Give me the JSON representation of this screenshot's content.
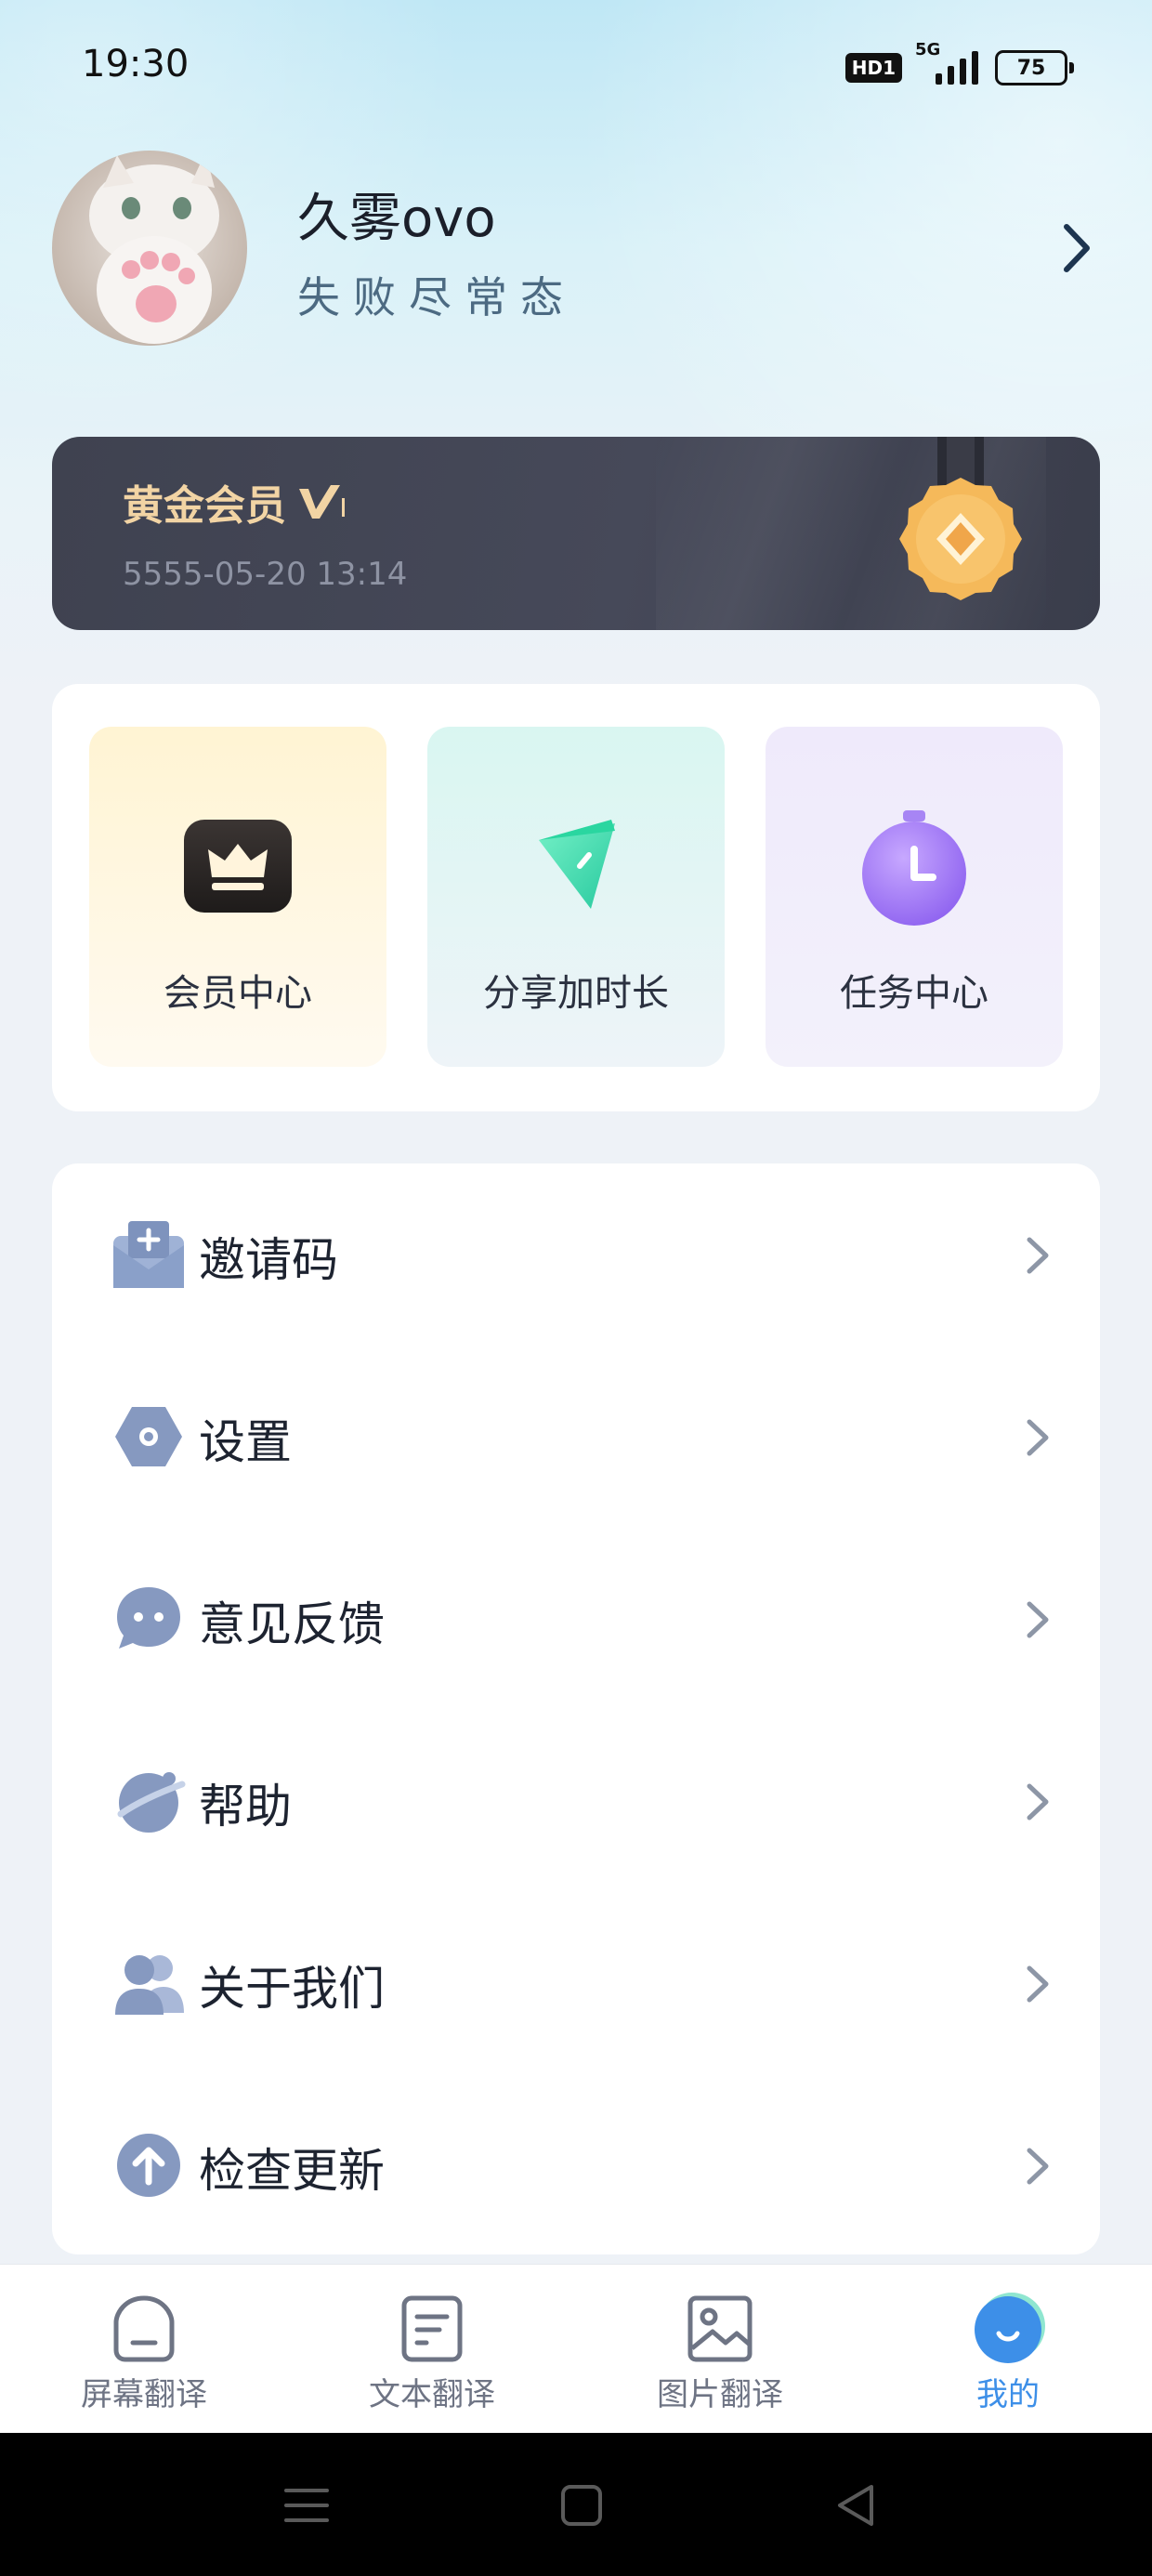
{
  "status_bar": {
    "time": "19:30",
    "hd_badge": "HD1",
    "network": "5G",
    "battery": "75"
  },
  "profile": {
    "name": "久雾ovo",
    "motto": "失败尽常态",
    "avatar_icon": "cat-paw-avatar",
    "arrow_icon": "chevron-right-icon"
  },
  "vip": {
    "title": "黄金会员",
    "badge_icon": "v-badge-icon",
    "expiry": "5555-05-20 13:14",
    "medal_icon": "gold-medal-icon",
    "text_color": "#f2d4a4"
  },
  "quick_actions": [
    {
      "label": "会员中心",
      "icon": "crown-icon"
    },
    {
      "label": "分享加时长",
      "icon": "share-send-icon"
    },
    {
      "label": "任务中心",
      "icon": "stopwatch-icon"
    }
  ],
  "menu": [
    {
      "label": "邀请码",
      "icon": "invite-mail-icon"
    },
    {
      "label": "设置",
      "icon": "settings-hex-icon"
    },
    {
      "label": "意见反馈",
      "icon": "feedback-chat-icon"
    },
    {
      "label": "帮助",
      "icon": "help-planet-icon"
    },
    {
      "label": "关于我们",
      "icon": "users-icon"
    },
    {
      "label": "检查更新",
      "icon": "upload-arrow-icon"
    }
  ],
  "tabbar": {
    "tabs": [
      {
        "label": "屏幕翻译",
        "icon": "screen-home-icon"
      },
      {
        "label": "文本翻译",
        "icon": "text-doc-icon"
      },
      {
        "label": "图片翻译",
        "icon": "image-icon"
      },
      {
        "label": "我的",
        "icon": "smile-avatar-icon"
      }
    ],
    "active_index": 3,
    "active_color": "#3d8fe8"
  },
  "system_nav": {
    "buttons": [
      "menu-lines-icon",
      "home-square-icon",
      "back-triangle-icon"
    ]
  }
}
